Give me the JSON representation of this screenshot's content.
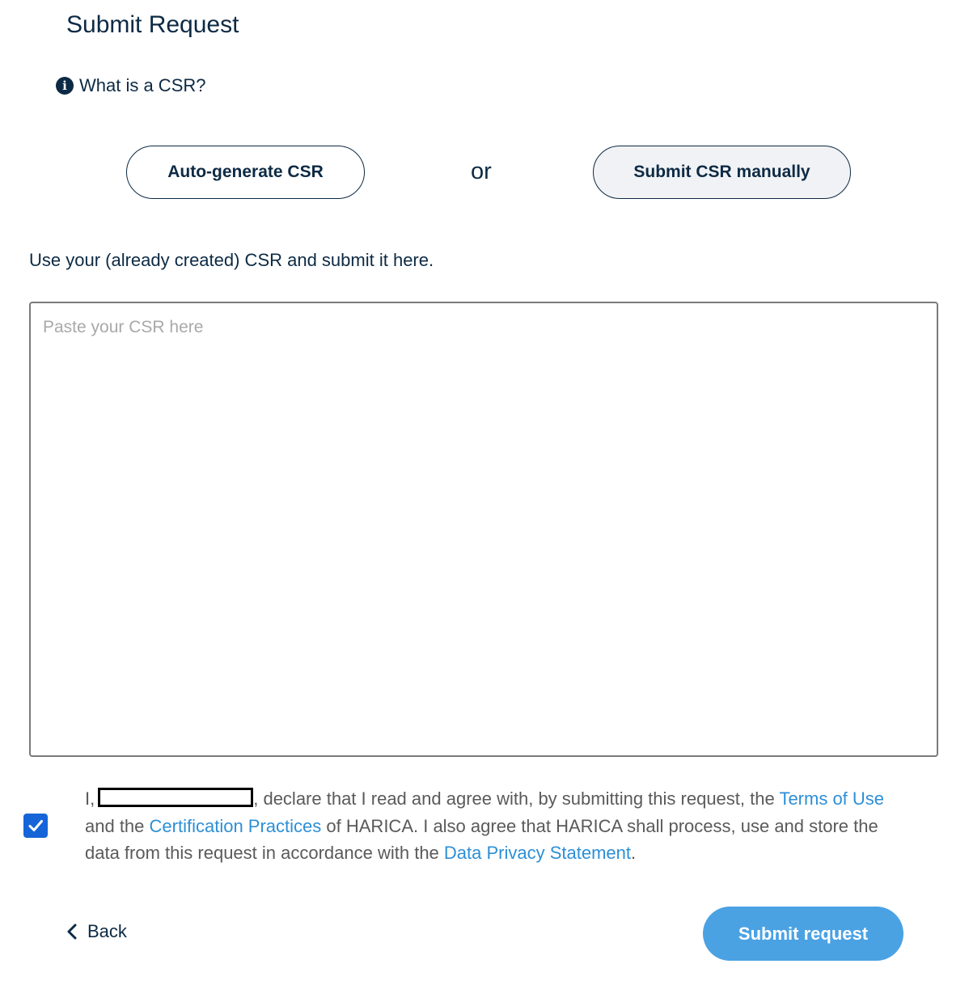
{
  "page": {
    "title": "Submit Request"
  },
  "help": {
    "icon": "info-circle-icon",
    "label": "What is a CSR?"
  },
  "csr_mode": {
    "auto_label": "Auto-generate CSR",
    "separator": "or",
    "manual_label": "Submit CSR manually",
    "selected": "Submit CSR manually"
  },
  "instructions": "Use your (already created) CSR and submit it here.",
  "csr_input": {
    "placeholder": "Paste your CSR here",
    "value": ""
  },
  "agreement": {
    "checked": true,
    "prefix": "I,",
    "part1": ", declare that I read and agree with, by submitting this request, the",
    "terms_link": "Terms of Use",
    "part2": "and the",
    "practices_link": "Certification Practices",
    "part3": "of HARICA. I also agree that HARICA shall process, use and store the data from this request in accordance with the",
    "privacy_link": "Data Privacy Statement",
    "suffix": "."
  },
  "footer": {
    "back_label": "Back",
    "submit_label": "Submit request"
  },
  "colors": {
    "primary_text": "#0d2a44",
    "link": "#2d8fd6",
    "submit_button": "#4aa2e3",
    "checkbox": "#1565d8"
  }
}
